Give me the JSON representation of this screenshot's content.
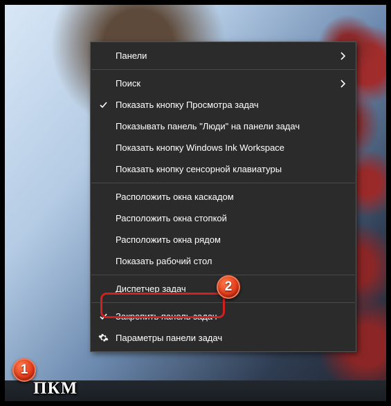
{
  "menu": {
    "items": [
      {
        "label": "Панели",
        "submenu": true
      },
      {
        "label": "Поиск",
        "submenu": true
      },
      {
        "label": "Показать кнопку Просмотра задач",
        "checked": true
      },
      {
        "label": "Показывать панель \"Люди\" на панели задач"
      },
      {
        "label": "Показать кнопку Windows Ink Workspace"
      },
      {
        "label": "Показать кнопку сенсорной клавиатуры"
      },
      {
        "label": "Расположить окна каскадом"
      },
      {
        "label": "Расположить окна стопкой"
      },
      {
        "label": "Расположить окна рядом"
      },
      {
        "label": "Показать рабочий стол"
      },
      {
        "label": "Диспетчер задач"
      },
      {
        "label": "Закрепить панель задач",
        "checked": true
      },
      {
        "label": "Параметры панели задач",
        "gear": true
      }
    ]
  },
  "annotations": {
    "badge1": "1",
    "badge2": "2",
    "pkm": "ПКМ"
  }
}
